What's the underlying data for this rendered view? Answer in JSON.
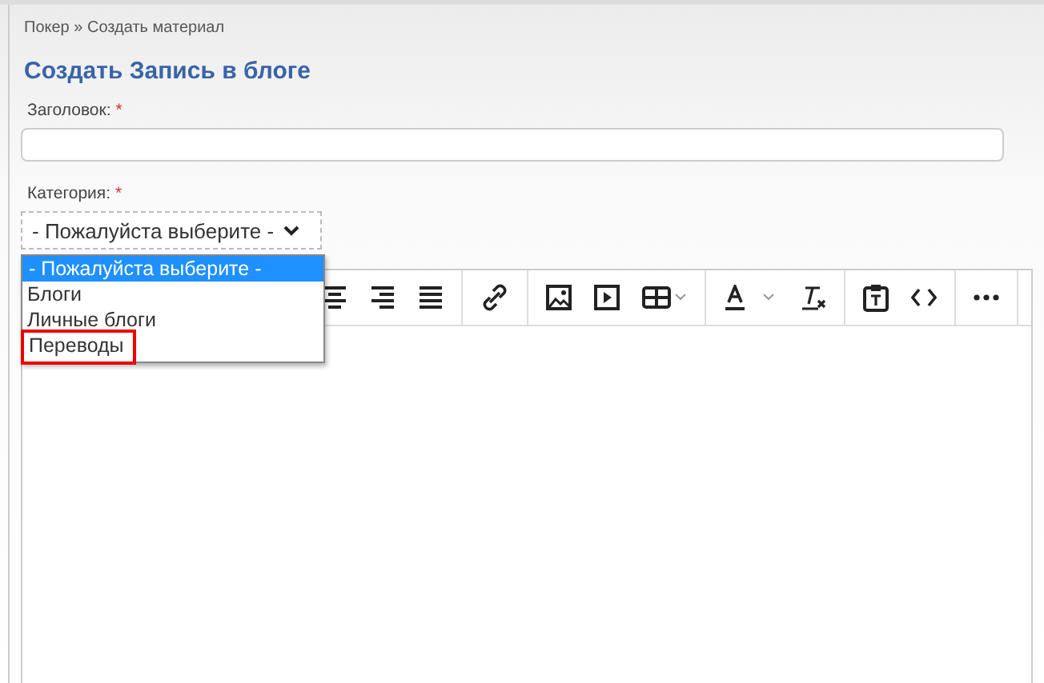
{
  "breadcrumb": "Покер » Создать материал",
  "heading": "Создать Запись в блоге",
  "fields": [
    {
      "label": "Заголовок:",
      "required_mark": "*"
    },
    {
      "label": "Категория:",
      "required_mark": "*"
    }
  ],
  "category_select": {
    "value": "- Пожалуйста выберите -",
    "expanded": true,
    "options": [
      {
        "label": "- Пожалуйста выберите -",
        "selected": true,
        "highlighted": false
      },
      {
        "label": "Блоги",
        "selected": false,
        "highlighted": false
      },
      {
        "label": "Личные блоги",
        "selected": false,
        "highlighted": false
      },
      {
        "label": "Переводы",
        "selected": false,
        "highlighted": true
      }
    ]
  },
  "toolbar": [
    {
      "kind": "align-center"
    },
    {
      "kind": "align-right"
    },
    {
      "kind": "justify"
    },
    {
      "kind": "sep"
    },
    {
      "kind": "link"
    },
    {
      "kind": "sep"
    },
    {
      "kind": "image"
    },
    {
      "kind": "media"
    },
    {
      "kind": "table"
    },
    {
      "kind": "sep"
    },
    {
      "kind": "text-color"
    },
    {
      "kind": "clear-format"
    },
    {
      "kind": "sep"
    },
    {
      "kind": "paste-text"
    },
    {
      "kind": "code"
    },
    {
      "kind": "sep"
    },
    {
      "kind": "more"
    },
    {
      "kind": "sep"
    }
  ]
}
